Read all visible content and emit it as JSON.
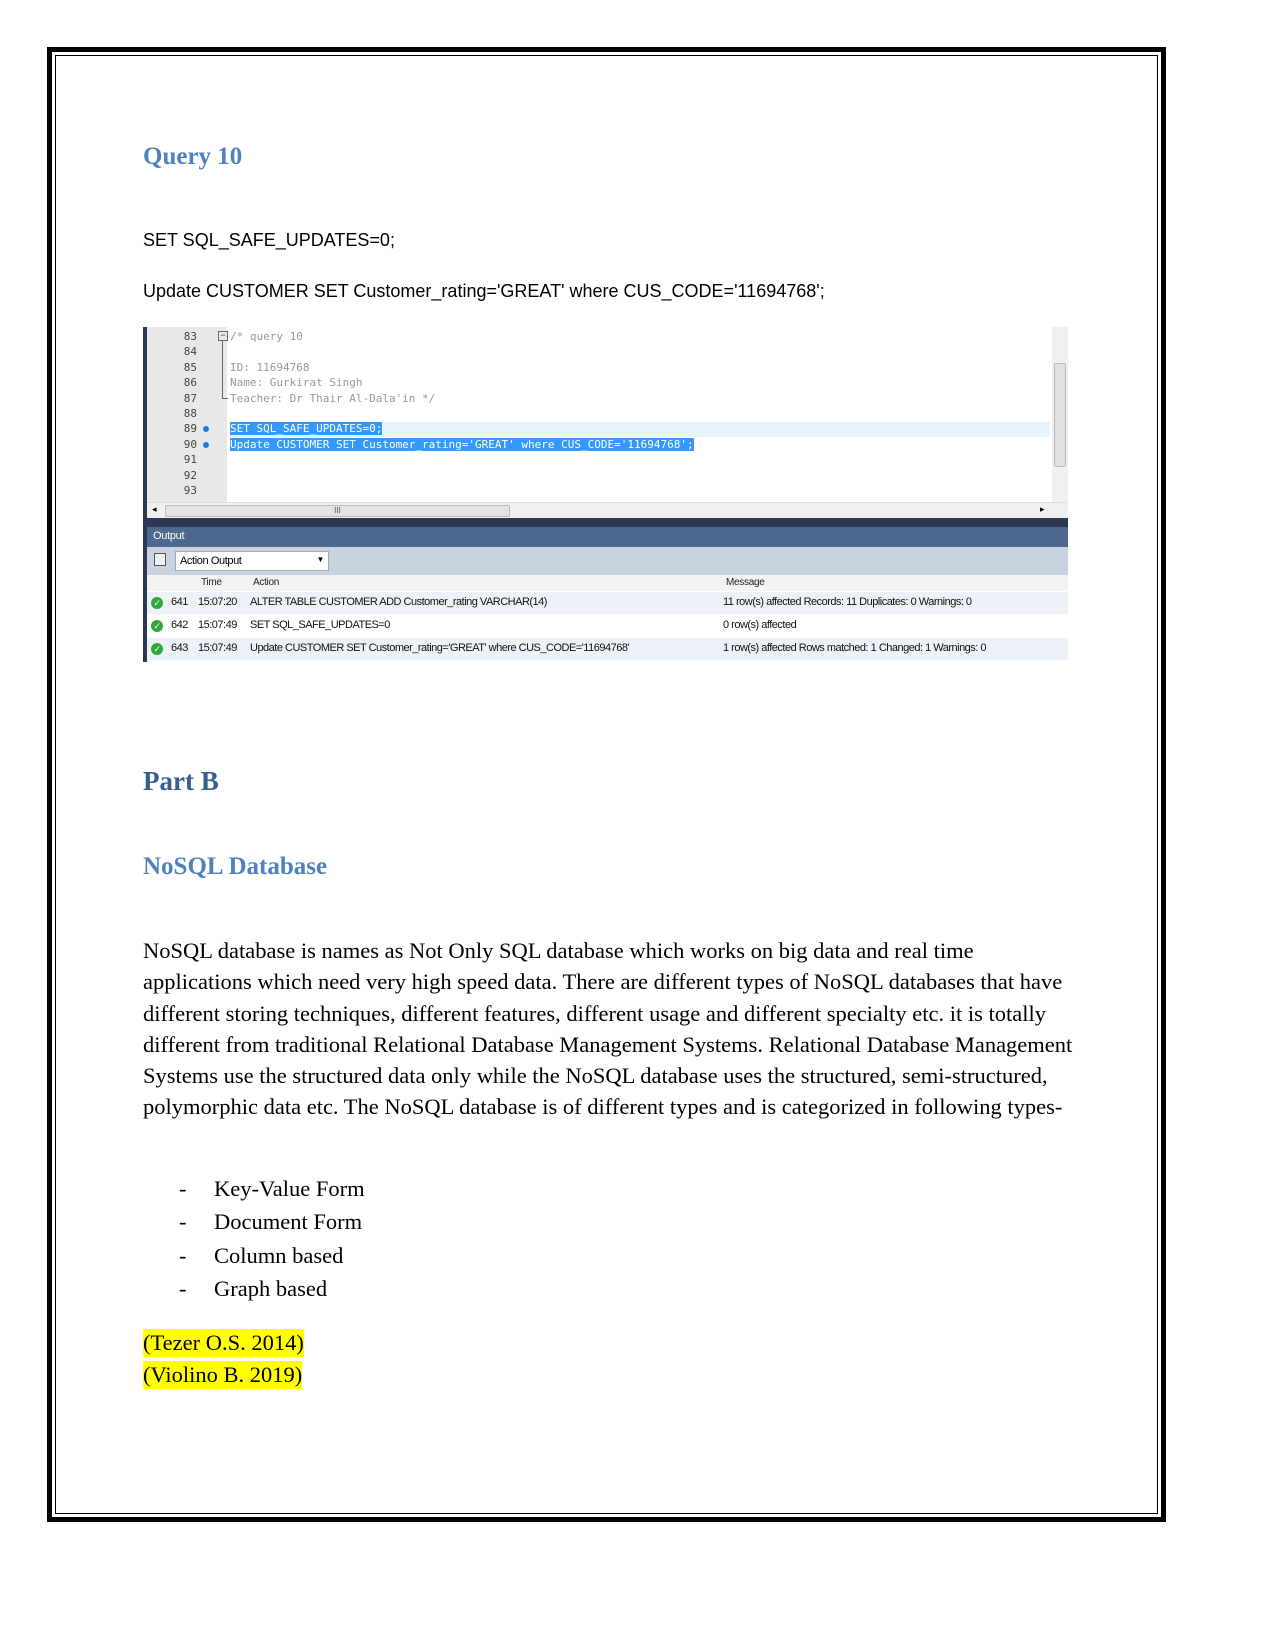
{
  "query_heading": "Query 10",
  "sql_lines": [
    "SET SQL_SAFE_UPDATES=0;",
    "Update CUSTOMER SET Customer_rating='GREAT' where CUS_CODE='11694768';"
  ],
  "editor": {
    "line_numbers": [
      "83",
      "84",
      "85",
      "86",
      "87",
      "88",
      "89",
      "90",
      "91",
      "92",
      "93"
    ],
    "code": [
      "/* query 10",
      "",
      "ID: 11694768",
      "Name: Gurkirat Singh",
      "Teacher: Dr Thair Al-Dala'in */",
      "",
      "SET SQL_SAFE_UPDATES=0;",
      "Update CUSTOMER SET Customer_rating='GREAT' where CUS_CODE='11694768';",
      "",
      "",
      ""
    ]
  },
  "output": {
    "title": "Output",
    "selector": "Action Output",
    "columns": {
      "time": "Time",
      "action": "Action",
      "message": "Message"
    },
    "rows": [
      {
        "id": "641",
        "time": "15:07:20",
        "action": "ALTER TABLE CUSTOMER ADD Customer_rating VARCHAR(14)",
        "message": "11 row(s) affected Records: 11  Duplicates: 0  Warnings: 0"
      },
      {
        "id": "642",
        "time": "15:07:49",
        "action": "SET SQL_SAFE_UPDATES=0",
        "message": "0 row(s) affected"
      },
      {
        "id": "643",
        "time": "15:07:49",
        "action": "Update CUSTOMER SET Customer_rating='GREAT' where CUS_CODE='11694768'",
        "message": "1 row(s) affected Rows matched: 1  Changed: 1  Warnings: 0"
      }
    ]
  },
  "part_heading": "Part B",
  "nosql_heading": "NoSQL Database",
  "paragraph": "NoSQL database is names as Not Only SQL database which works on big data and real time applications which need very high speed data.  There are different types of NoSQL databases that have different storing techniques, different features, different usage and different specialty etc. it is totally different from traditional Relational Database Management Systems. Relational Database Management Systems use the structured data only while the NoSQL database uses the structured, semi-structured, polymorphic data etc. The NoSQL database is of different types and is categorized in following types-",
  "bullet_marker": "-",
  "types": [
    "Key-Value Form",
    "Document Form",
    "Column based",
    "Graph based"
  ],
  "references": [
    "(Tezer O.S. 2014)",
    "(Violino B. 2019)"
  ]
}
